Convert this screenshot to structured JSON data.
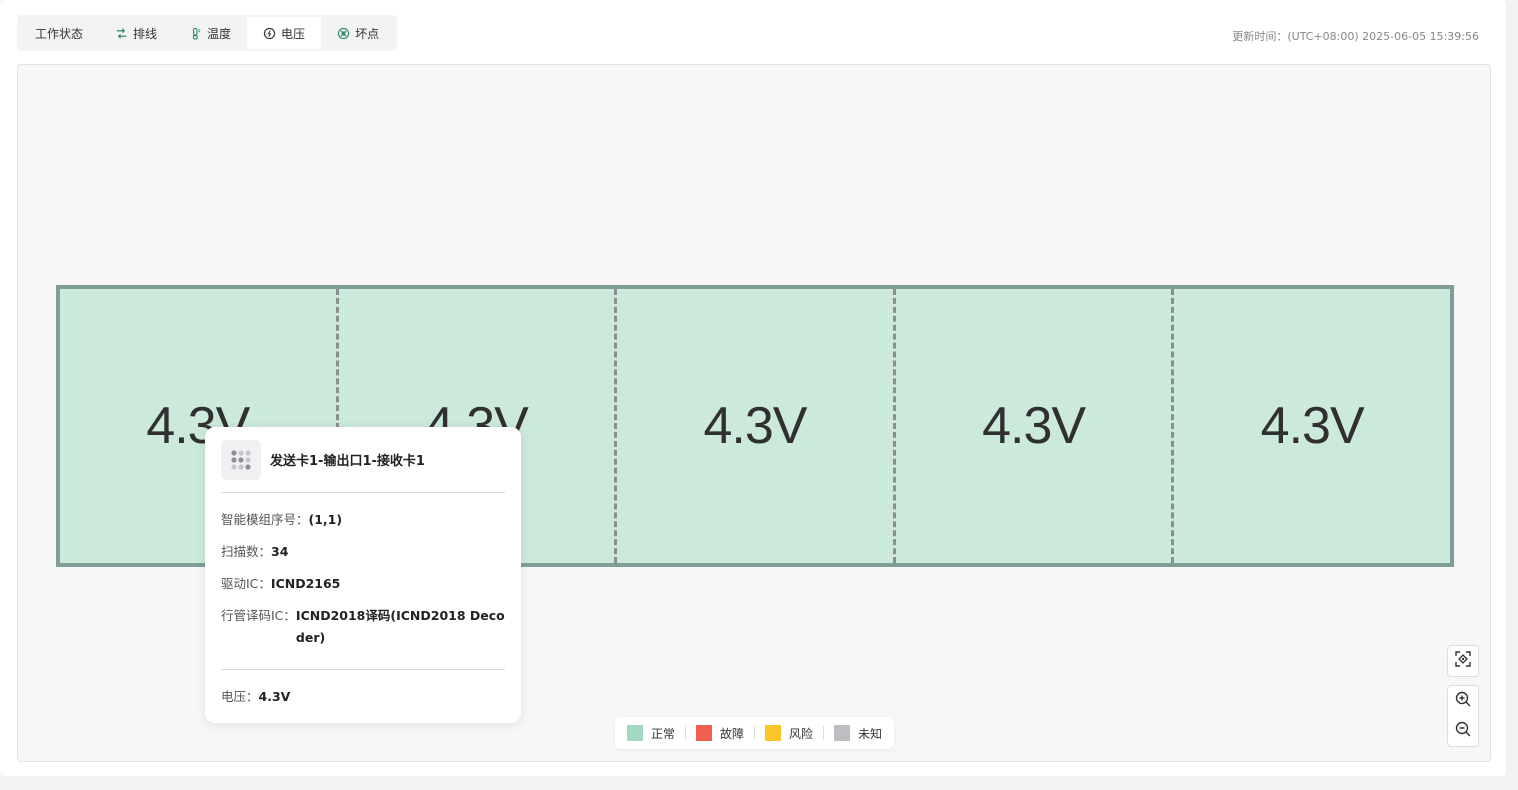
{
  "tabs": [
    {
      "label": "工作状态",
      "icon": "",
      "active": false
    },
    {
      "label": "排线",
      "icon": "cable-icon",
      "active": false
    },
    {
      "label": "温度",
      "icon": "thermometer-icon",
      "active": false
    },
    {
      "label": "电压",
      "icon": "voltage-gauge-icon",
      "active": true
    },
    {
      "label": "坏点",
      "icon": "dead-pixel-icon",
      "active": false
    }
  ],
  "update_time": "更新时间：(UTC+08:00) 2025-06-05 15:39:56",
  "modules": [
    "4.3V",
    "4.3V",
    "4.3V",
    "4.3V",
    "4.3V"
  ],
  "tooltip": {
    "title": "发送卡1-输出口1-接收卡1",
    "rows": [
      {
        "key": "智能模组序号：",
        "value": "(1,1)"
      },
      {
        "key": "扫描数：",
        "value": "34"
      },
      {
        "key": "驱动IC：",
        "value": "ICND2165"
      },
      {
        "key": "行管译码IC：",
        "value": "ICND2018译码(ICND2018 Decoder)"
      }
    ],
    "footer": {
      "key": "电压：",
      "value": "4.3V"
    }
  },
  "legend": [
    {
      "label": "正常",
      "color": "#a3d9c0"
    },
    {
      "label": "故障",
      "color": "#f26150"
    },
    {
      "label": "风险",
      "color": "#f9c629"
    },
    {
      "label": "未知",
      "color": "#bdbec1"
    }
  ],
  "colors": {
    "module_fill": "#cbeadb",
    "module_border": "#7e9e97",
    "active_tab": "#ffffff"
  }
}
